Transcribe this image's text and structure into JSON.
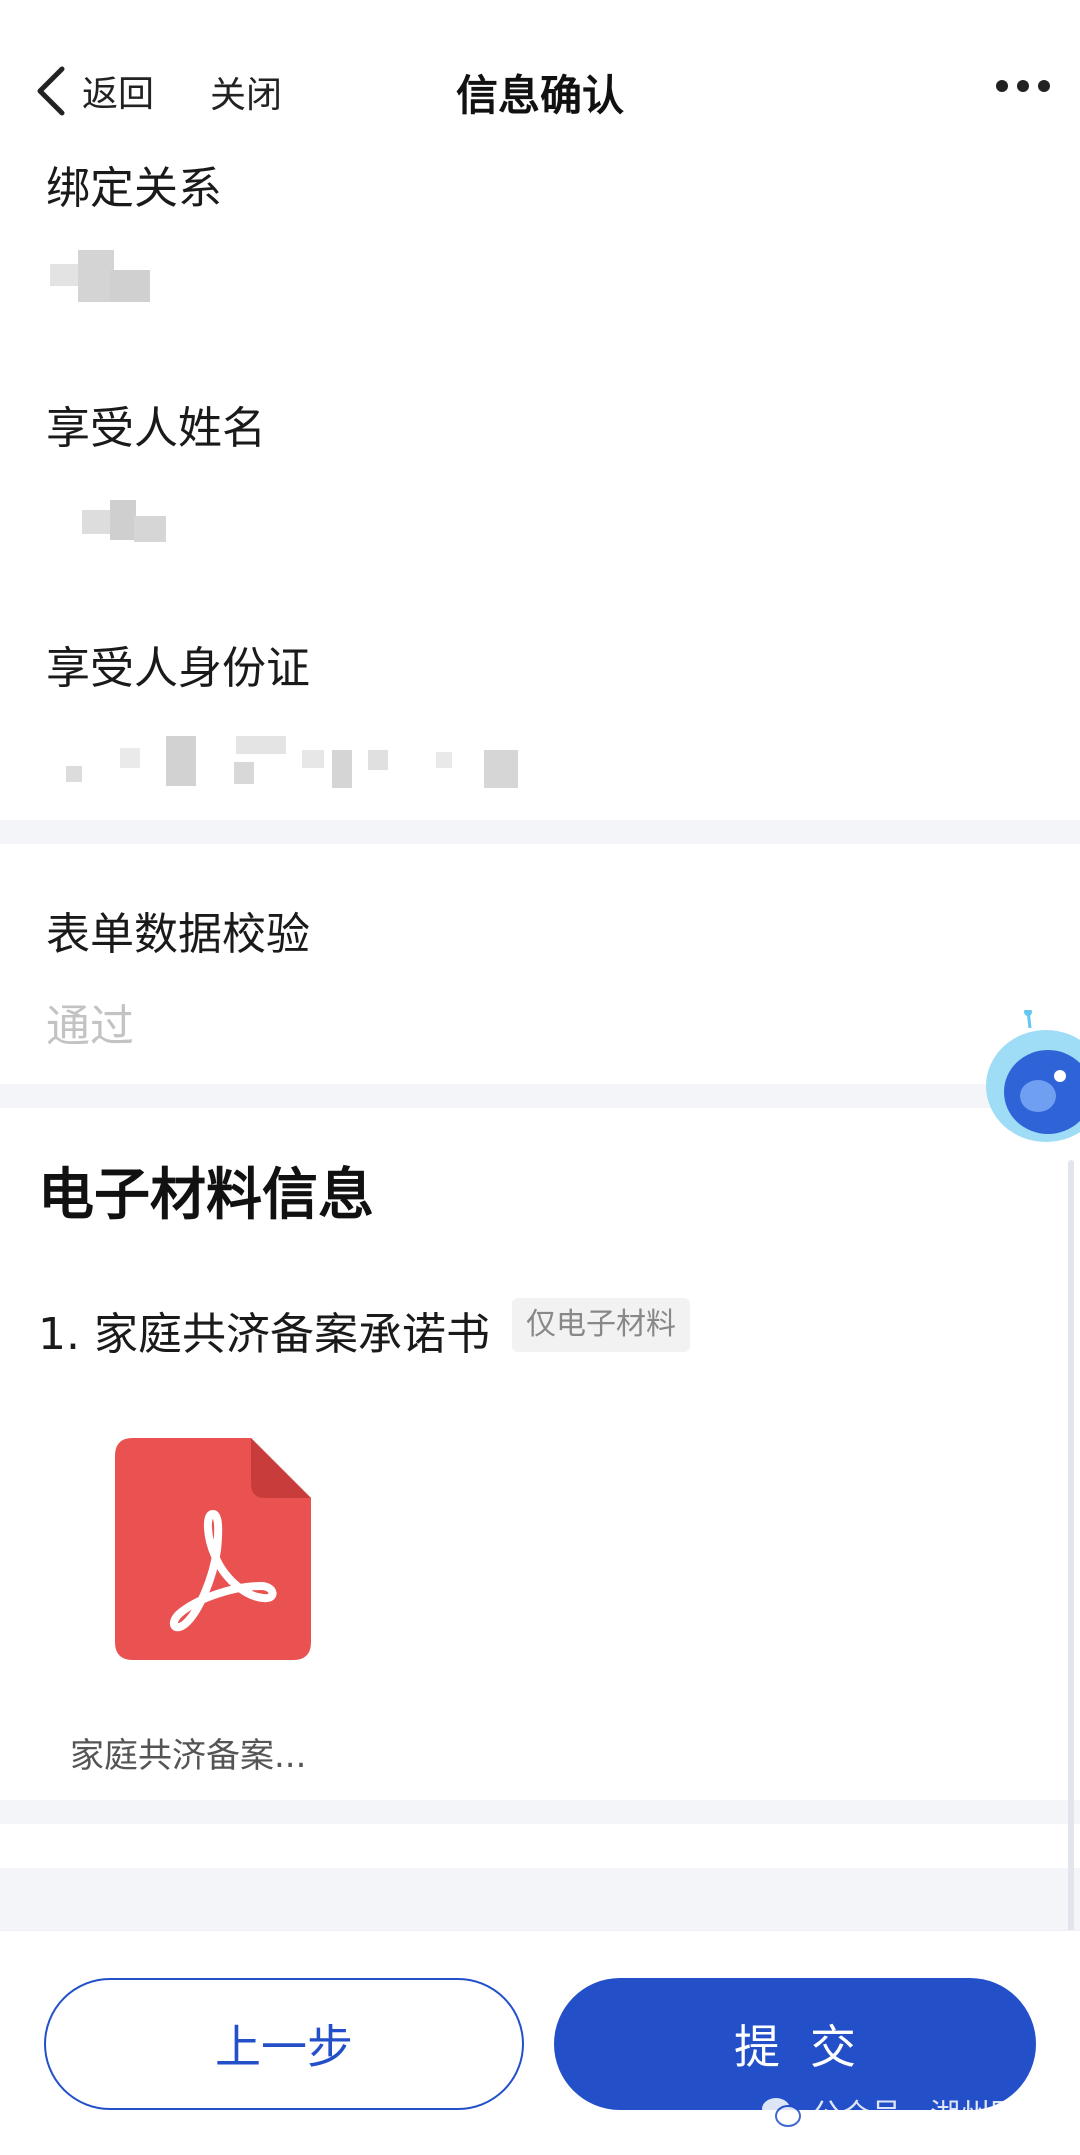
{
  "header": {
    "back_label": "返回",
    "close_label": "关闭",
    "title": "信息确认"
  },
  "fields": {
    "binding_relation_label": "绑定关系",
    "beneficiary_name_label": "享受人姓名",
    "beneficiary_id_label": "享受人身份证",
    "form_validation_label": "表单数据校验",
    "form_validation_value": "通过"
  },
  "materials": {
    "section_title": "电子材料信息",
    "item_title": "1. 家庭共济备案承诺书",
    "item_tag": "仅电子材料",
    "file_name": "家庭共济备案..."
  },
  "actions": {
    "prev_label": "上一步",
    "submit_label": "提交"
  },
  "watermark": {
    "text": "公众号 · 湖州医保"
  },
  "colors": {
    "primary": "#2350c8",
    "pdf_red": "#ea5252",
    "muted_text": "#c3c3c3",
    "band": "#f3f5f8"
  },
  "icons": {
    "back": "chevron-left-icon",
    "more": "more-dots-icon",
    "pdf": "pdf-file-icon",
    "assistant": "assistant-mascot-icon",
    "wechat": "wechat-icon"
  }
}
